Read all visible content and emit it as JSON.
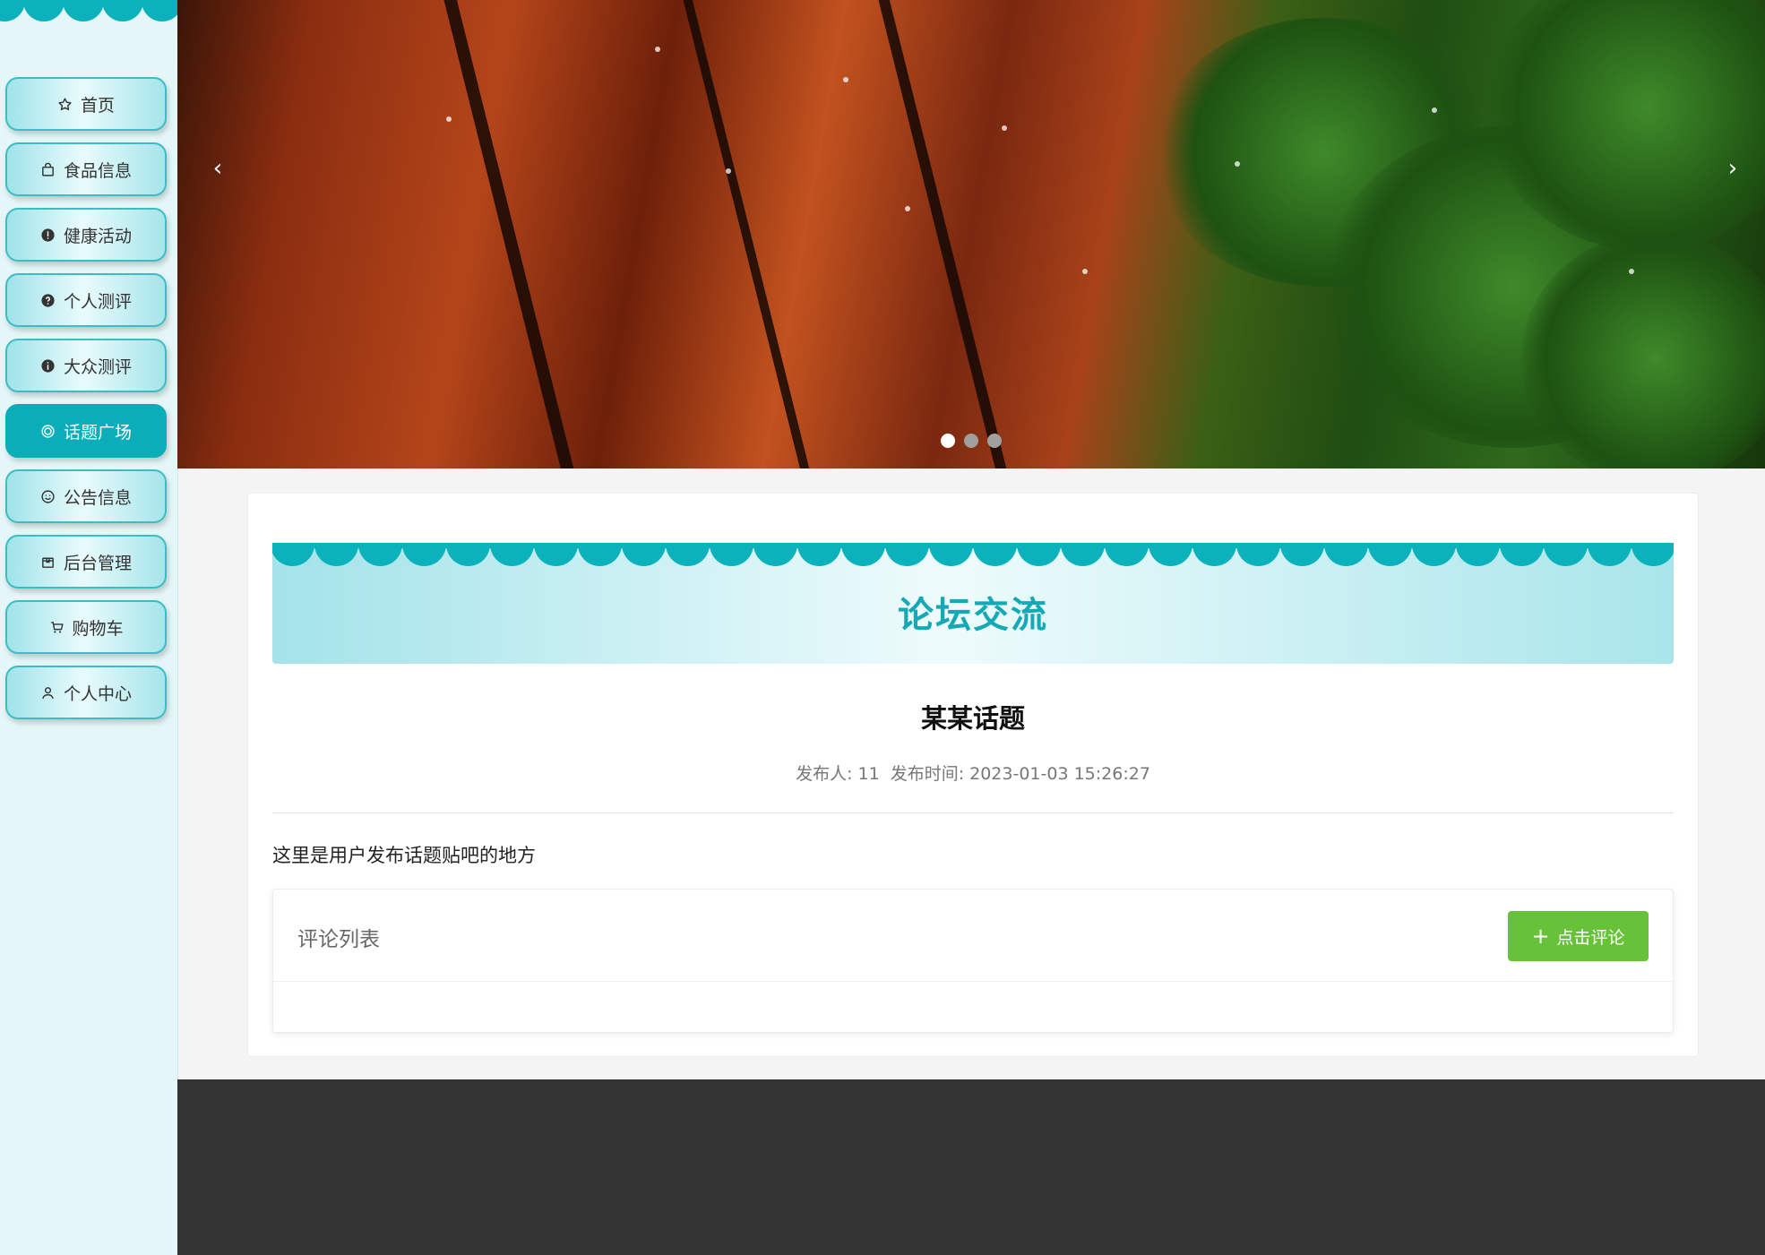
{
  "nav": {
    "items": [
      {
        "label": "首页",
        "icon": "star-icon",
        "active": false
      },
      {
        "label": "食品信息",
        "icon": "bag-icon",
        "active": false
      },
      {
        "label": "健康活动",
        "icon": "warning-circle-icon",
        "active": false
      },
      {
        "label": "个人测评",
        "icon": "question-circle-icon",
        "active": false
      },
      {
        "label": "大众测评",
        "icon": "info-circle-icon",
        "active": false
      },
      {
        "label": "话题广场",
        "icon": "target-icon",
        "active": true
      },
      {
        "label": "公告信息",
        "icon": "smile-icon",
        "active": false
      },
      {
        "label": "后台管理",
        "icon": "box-icon",
        "active": false
      },
      {
        "label": "购物车",
        "icon": "cart-icon",
        "active": false
      },
      {
        "label": "个人中心",
        "icon": "user-icon",
        "active": false
      }
    ]
  },
  "banner": {
    "prev_arrow": "‹",
    "next_arrow": "›",
    "slide_count": 3,
    "active_slide": 1
  },
  "section": {
    "title": "论坛交流"
  },
  "topic": {
    "title": "某某话题",
    "publisher_label": "发布人:",
    "publisher": "11",
    "time_label": "发布时间:",
    "time": "2023-01-03 15:26:27",
    "content": "这里是用户发布话题贴吧的地方"
  },
  "comments": {
    "label": "评论列表",
    "button_label": "点击评论",
    "button_icon": "plus-icon"
  },
  "colors": {
    "accent": "#0bb2bc",
    "title": "#14a9b5",
    "button": "#67c23a",
    "footer": "#333333"
  }
}
